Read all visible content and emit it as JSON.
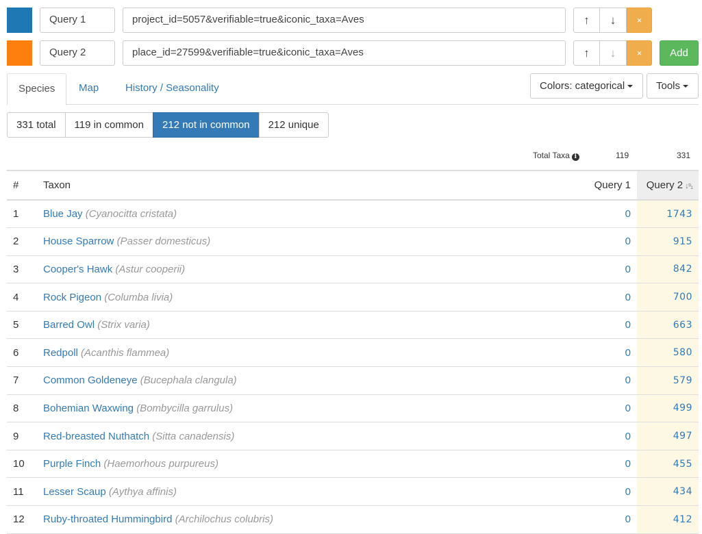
{
  "queries": [
    {
      "name": "Query 1",
      "params": "project_id=5057&verifiable=true&iconic_taxa=Aves",
      "color": "#1f77b4"
    },
    {
      "name": "Query 2",
      "params": "place_id=27599&verifiable=true&iconic_taxa=Aves",
      "color": "#ff7f0e"
    }
  ],
  "icons": {
    "up": "↑",
    "down": "↓",
    "remove": "×"
  },
  "add_label": "Add",
  "tabs": [
    {
      "label": "Species",
      "active": true
    },
    {
      "label": "Map",
      "active": false
    },
    {
      "label": "History / Seasonality",
      "active": false
    }
  ],
  "colors_button": "Colors: categorical",
  "tools_button": "Tools",
  "filters": [
    {
      "label": "331 total",
      "active": false
    },
    {
      "label": "119 in common",
      "active": false
    },
    {
      "label": "212 not in common",
      "active": true
    },
    {
      "label": "212 unique",
      "active": false
    }
  ],
  "totals": {
    "label": "Total Taxa",
    "q1": "119",
    "q2": "331"
  },
  "table": {
    "headers": {
      "num": "#",
      "taxon": "Taxon",
      "q1": "Query 1",
      "q2": "Query 2"
    },
    "rows": [
      {
        "n": "1",
        "common": "Blue Jay",
        "sci": "(Cyanocitta cristata)",
        "q1": "0",
        "q2": "1743"
      },
      {
        "n": "2",
        "common": "House Sparrow",
        "sci": "(Passer domesticus)",
        "q1": "0",
        "q2": "915"
      },
      {
        "n": "3",
        "common": "Cooper's Hawk",
        "sci": "(Astur cooperii)",
        "q1": "0",
        "q2": "842"
      },
      {
        "n": "4",
        "common": "Rock Pigeon",
        "sci": "(Columba livia)",
        "q1": "0",
        "q2": "700"
      },
      {
        "n": "5",
        "common": "Barred Owl",
        "sci": "(Strix varia)",
        "q1": "0",
        "q2": "663"
      },
      {
        "n": "6",
        "common": "Redpoll",
        "sci": "(Acanthis flammea)",
        "q1": "0",
        "q2": "580"
      },
      {
        "n": "7",
        "common": "Common Goldeneye",
        "sci": "(Bucephala clangula)",
        "q1": "0",
        "q2": "579"
      },
      {
        "n": "8",
        "common": "Bohemian Waxwing",
        "sci": "(Bombycilla garrulus)",
        "q1": "0",
        "q2": "499"
      },
      {
        "n": "9",
        "common": "Red-breasted Nuthatch",
        "sci": "(Sitta canadensis)",
        "q1": "0",
        "q2": "497"
      },
      {
        "n": "10",
        "common": "Purple Finch",
        "sci": "(Haemorhous purpureus)",
        "q1": "0",
        "q2": "455"
      },
      {
        "n": "11",
        "common": "Lesser Scaup",
        "sci": "(Aythya affinis)",
        "q1": "0",
        "q2": "434"
      },
      {
        "n": "12",
        "common": "Ruby-throated Hummingbird",
        "sci": "(Archilochus colubris)",
        "q1": "0",
        "q2": "412"
      }
    ]
  }
}
